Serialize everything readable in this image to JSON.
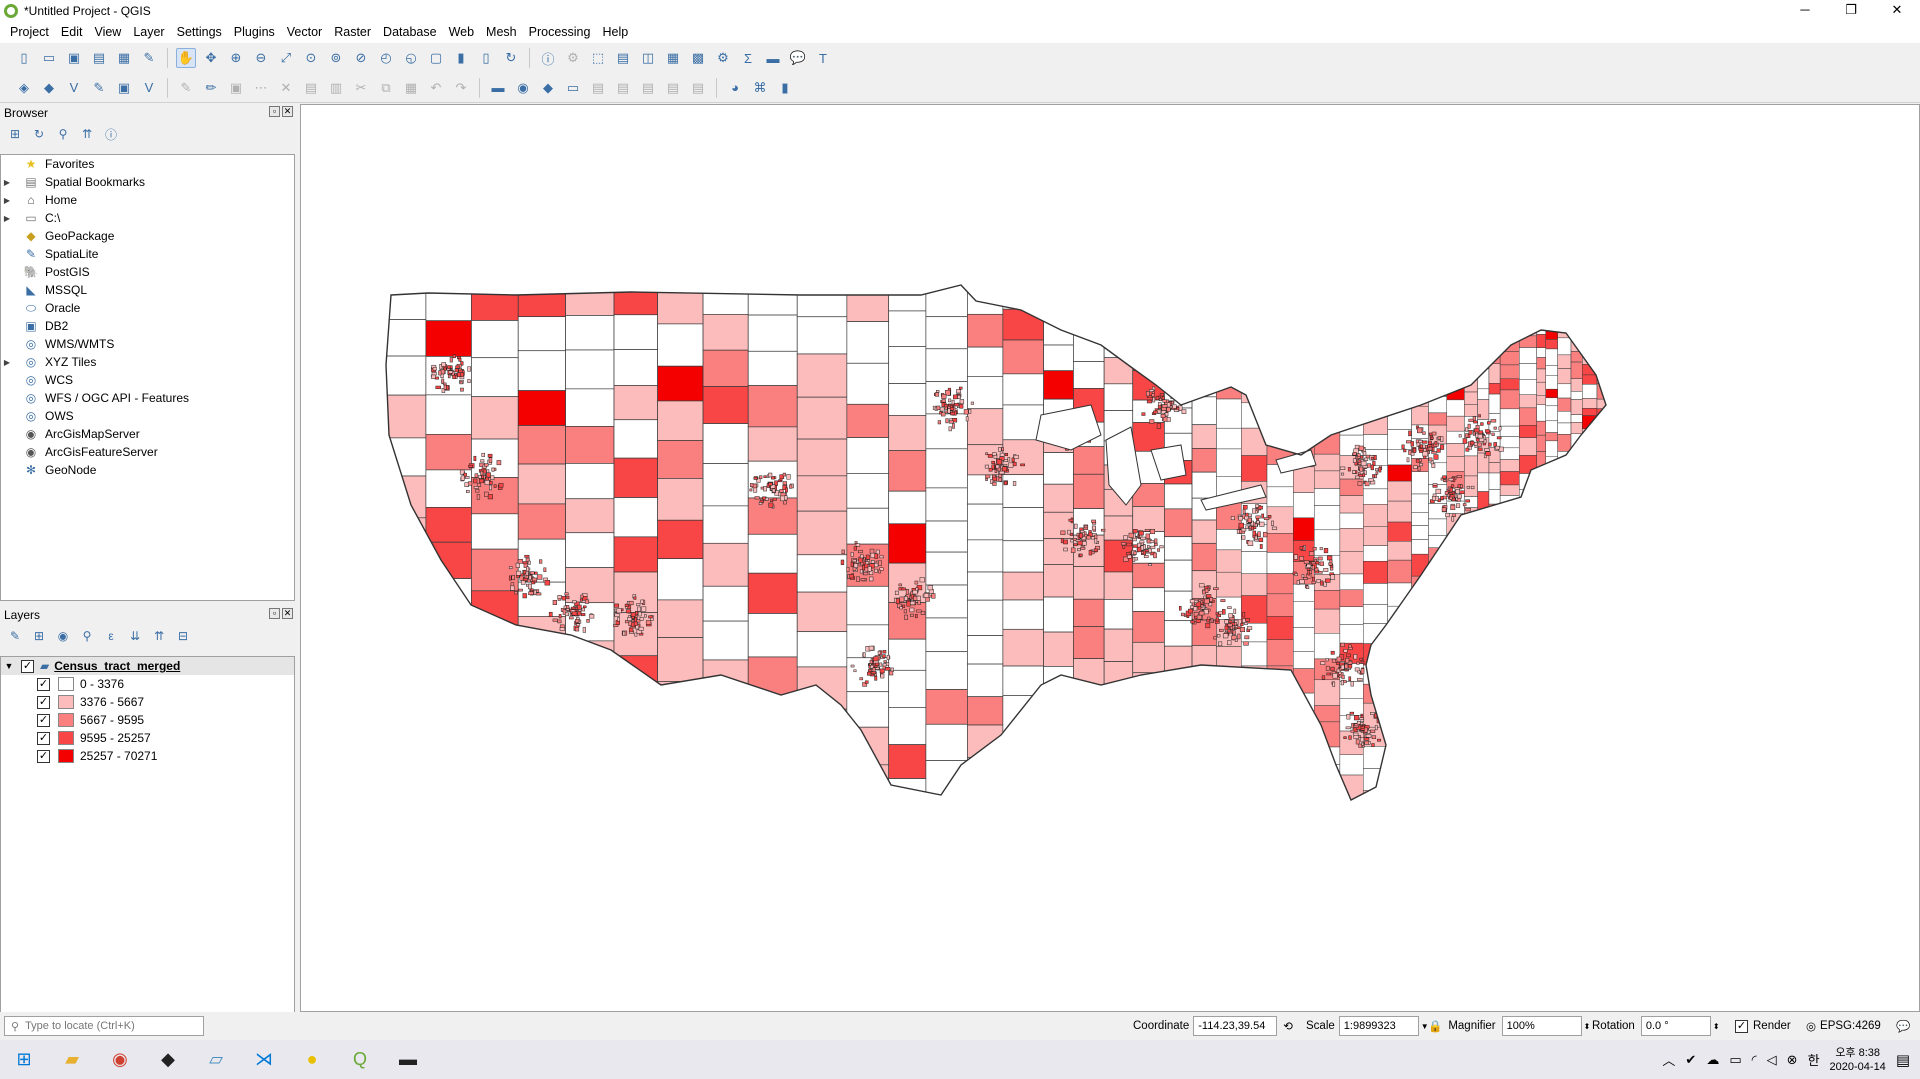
{
  "window": {
    "title": "*Untitled Project - QGIS",
    "minimize": "─",
    "restore": "❐",
    "close": "✕"
  },
  "menus": [
    "Project",
    "Edit",
    "View",
    "Layer",
    "Settings",
    "Plugins",
    "Vector",
    "Raster",
    "Database",
    "Web",
    "Mesh",
    "Processing",
    "Help"
  ],
  "browser": {
    "title": "Browser",
    "items": [
      {
        "label": "Favorites",
        "icon": "star-icon",
        "glyph": "★",
        "color": "#e8c020",
        "expandable": false
      },
      {
        "label": "Spatial Bookmarks",
        "icon": "bookmark-icon",
        "glyph": "▤",
        "color": "#777777",
        "expandable": true
      },
      {
        "label": "Home",
        "icon": "home-icon",
        "glyph": "⌂",
        "color": "#555555",
        "expandable": true
      },
      {
        "label": "C:\\",
        "icon": "folder-icon",
        "glyph": "▭",
        "color": "#777777",
        "expandable": true
      },
      {
        "label": "GeoPackage",
        "icon": "geopackage-icon",
        "glyph": "◆",
        "color": "#c8a020",
        "expandable": false
      },
      {
        "label": "SpatiaLite",
        "icon": "spatialite-icon",
        "glyph": "✎",
        "color": "#3a6ea5",
        "expandable": false
      },
      {
        "label": "PostGIS",
        "icon": "postgis-icon",
        "glyph": "🐘",
        "color": "#3a6ea5",
        "expandable": false
      },
      {
        "label": "MSSQL",
        "icon": "mssql-icon",
        "glyph": "◣",
        "color": "#3a6ea5",
        "expandable": false
      },
      {
        "label": "Oracle",
        "icon": "oracle-icon",
        "glyph": "⬭",
        "color": "#3a6ea5",
        "expandable": false
      },
      {
        "label": "DB2",
        "icon": "db2-icon",
        "glyph": "▣",
        "color": "#3a6ea5",
        "expandable": false
      },
      {
        "label": "WMS/WMTS",
        "icon": "wms-icon",
        "glyph": "◎",
        "color": "#3a6ea5",
        "expandable": false
      },
      {
        "label": "XYZ Tiles",
        "icon": "xyz-tiles-icon",
        "glyph": "◎",
        "color": "#3a6ea5",
        "expandable": true
      },
      {
        "label": "WCS",
        "icon": "wcs-icon",
        "glyph": "◎",
        "color": "#3a6ea5",
        "expandable": false
      },
      {
        "label": "WFS / OGC API - Features",
        "icon": "wfs-icon",
        "glyph": "◎",
        "color": "#3a6ea5",
        "expandable": false
      },
      {
        "label": "OWS",
        "icon": "ows-icon",
        "glyph": "◎",
        "color": "#3a6ea5",
        "expandable": false
      },
      {
        "label": "ArcGisMapServer",
        "icon": "arcgis-map-icon",
        "glyph": "◉",
        "color": "#555555",
        "expandable": false
      },
      {
        "label": "ArcGisFeatureServer",
        "icon": "arcgis-feature-icon",
        "glyph": "◉",
        "color": "#555555",
        "expandable": false
      },
      {
        "label": "GeoNode",
        "icon": "geonode-icon",
        "glyph": "✻",
        "color": "#3a6ea5",
        "expandable": false
      }
    ]
  },
  "layers": {
    "title": "Layers",
    "layer_name": "Census_tract_merged",
    "classes": [
      {
        "label": "0 - 3376",
        "color": "#ffffff"
      },
      {
        "label": "3376 - 5667",
        "color": "#fcbcbc"
      },
      {
        "label": "5667 - 9595",
        "color": "#fa8080"
      },
      {
        "label": "9595 - 25257",
        "color": "#f84646"
      },
      {
        "label": "25257 - 70271",
        "color": "#f50000"
      }
    ]
  },
  "status": {
    "locator_placeholder": "Type to locate (Ctrl+K)",
    "coordinate_label": "Coordinate",
    "coordinate_value": "-114.23,39.54",
    "scale_label": "Scale",
    "scale_value": "1:9899323",
    "magnifier_label": "Magnifier",
    "magnifier_value": "100%",
    "rotation_label": "Rotation",
    "rotation_value": "0.0 °",
    "render_label": "Render",
    "crs": "EPSG:4269"
  },
  "taskbar": {
    "time": "오후 8:38",
    "date": "2020-04-14",
    "ime": "한"
  }
}
